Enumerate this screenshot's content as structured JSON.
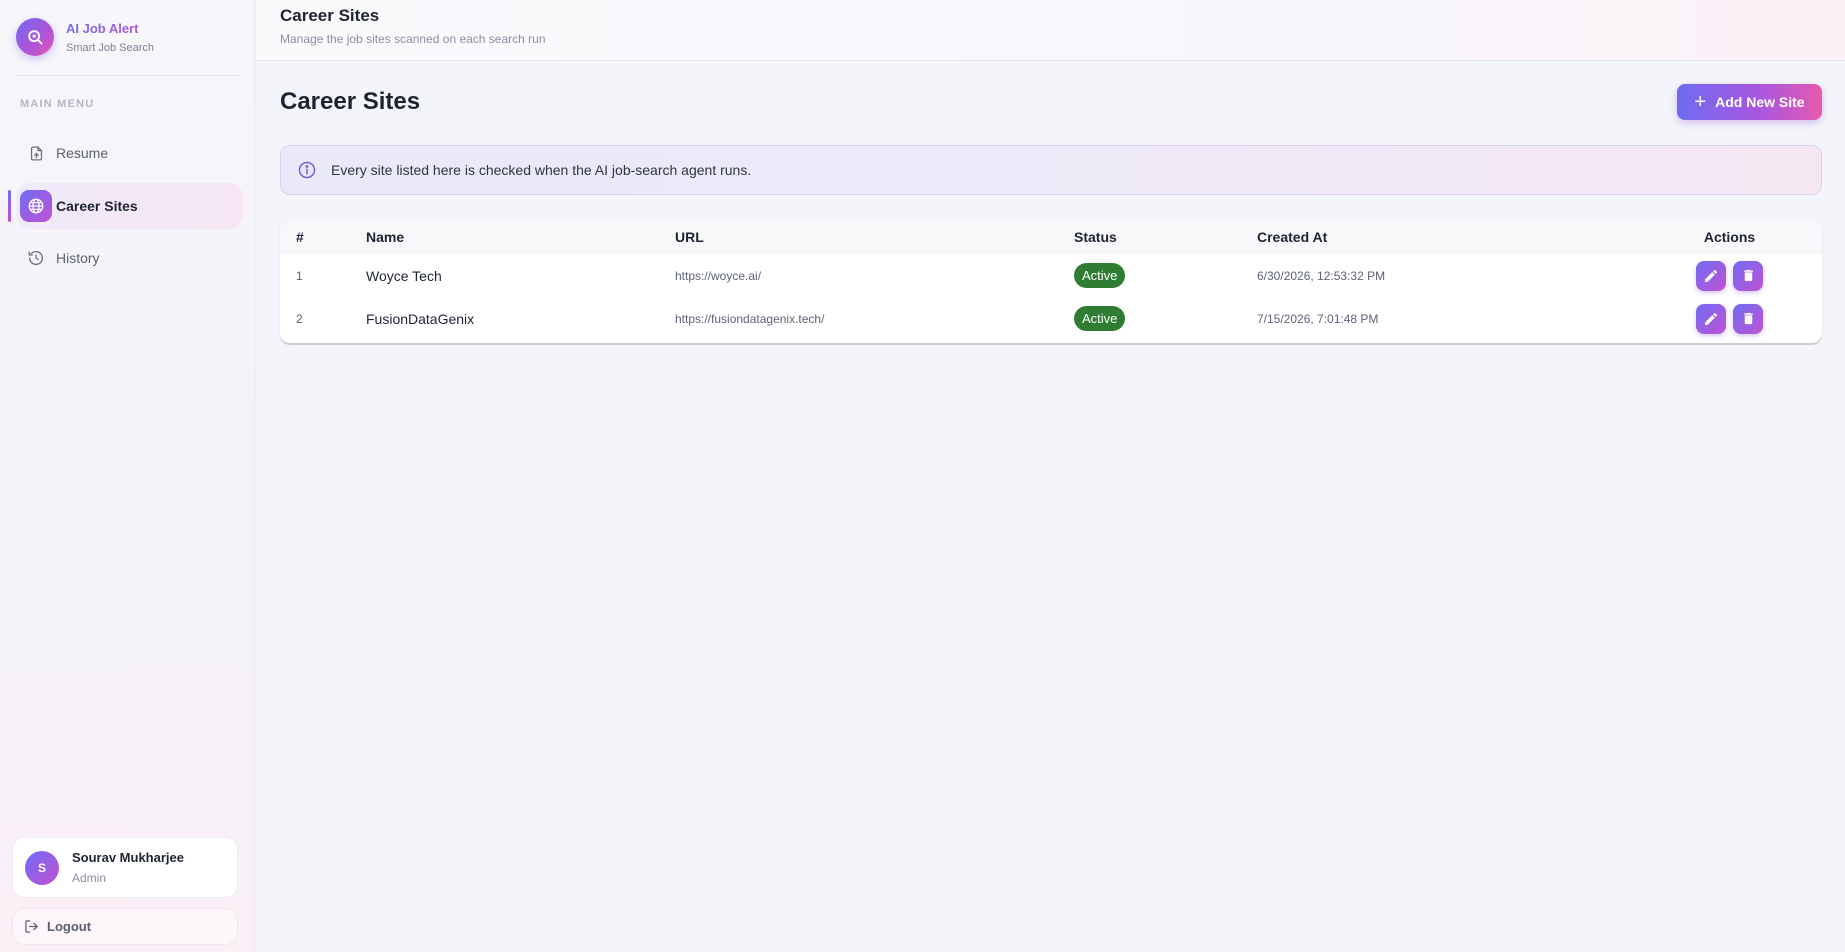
{
  "brand": {
    "title": "AI Job Alert",
    "subtitle": "Smart Job Search"
  },
  "sidebar": {
    "menu_heading": "MAIN MENU",
    "items": [
      {
        "label": "Resume",
        "icon": "file-upload-icon",
        "active": false
      },
      {
        "label": "Career Sites",
        "icon": "globe-icon",
        "active": true
      },
      {
        "label": "History",
        "icon": "history-icon",
        "active": false
      }
    ]
  },
  "user": {
    "initial": "S",
    "name": "Sourav Mukharjee",
    "role": "Admin"
  },
  "logout_label": "Logout",
  "header": {
    "title": "Career Sites",
    "subtitle": "Manage the job sites scanned on each search run"
  },
  "main": {
    "title": "Career Sites",
    "add_button": "Add New Site",
    "info": "Every site listed here is checked when the AI job-search agent runs."
  },
  "table": {
    "columns": [
      "#",
      "Name",
      "URL",
      "Status",
      "Created At",
      "Actions"
    ],
    "rows": [
      {
        "num": "1",
        "name": "Woyce Tech",
        "url": "https://woyce.ai/",
        "status": "Active",
        "created": "6/30/2026, 12:53:32 PM"
      },
      {
        "num": "2",
        "name": "FusionDataGenix",
        "url": "https://fusiondatagenix.tech/",
        "status": "Active",
        "created": "7/15/2026, 7:01:48 PM"
      }
    ]
  },
  "colors": {
    "accent_start": "#6f6cf2",
    "accent_end": "#e55aae",
    "status_active": "#2e7d32"
  }
}
